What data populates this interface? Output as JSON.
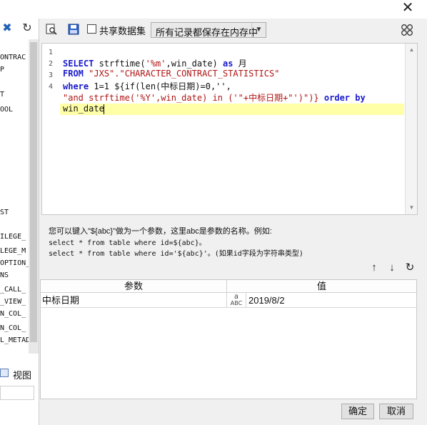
{
  "window": {
    "close_glyph": "✕"
  },
  "left_panel": {
    "items": [
      "ONTRAC",
      "P",
      "T",
      "OOL",
      "ST",
      "ILEGE_",
      "LEGE_M",
      "OPTION_",
      "NS",
      "_CALL_",
      "_VIEW_",
      "N_COL_",
      "N_COL_",
      "L_METAD"
    ],
    "view_label": "视图"
  },
  "toolbar": {
    "share_label": "共享数据集",
    "storage_select": "所有记录都保存在内存中"
  },
  "editor": {
    "line_numbers": [
      "1",
      "2",
      "3",
      "4"
    ],
    "lines": [
      [
        {
          "t": "SELECT",
          "c": "kw"
        },
        {
          "t": " strftime(",
          "c": ""
        },
        {
          "t": "'%m'",
          "c": "str"
        },
        {
          "t": ",win_date) ",
          "c": ""
        },
        {
          "t": "as",
          "c": "kw"
        },
        {
          "t": " 月",
          "c": ""
        }
      ],
      [
        {
          "t": "FROM",
          "c": "kw"
        },
        {
          "t": " ",
          "c": ""
        },
        {
          "t": "\"JXS\".\"CHARACTER_CONTRACT_STATISTICS\"",
          "c": "str"
        }
      ],
      [
        {
          "t": "where",
          "c": "kw"
        },
        {
          "t": " 1=1 ${if(len(中标日期)=0,'',",
          "c": ""
        }
      ],
      [
        {
          "t": "\"and strftime('%Y',win_date) in ('\"+中标日期+\"')\")}",
          "c": "str"
        },
        {
          "t": " ",
          "c": ""
        },
        {
          "t": "order by",
          "c": "kw"
        }
      ],
      [
        {
          "t": "win_date",
          "c": ""
        }
      ]
    ]
  },
  "hint": {
    "line1": "您可以键入\"${abc}\"做为一个参数，这里abc是参数的名称。例如:",
    "line2": "select * from table where id=${abc}。",
    "line3": "select * from table where id='${abc}'。(如果id字段为字符串类型)"
  },
  "params": {
    "col_name": "参数",
    "col_value": "值",
    "rows": [
      {
        "name": "中标日期",
        "type_glyph": "ABC",
        "value": "2019/8/2"
      }
    ]
  },
  "buttons": {
    "ok": "确定",
    "cancel": "取消"
  }
}
